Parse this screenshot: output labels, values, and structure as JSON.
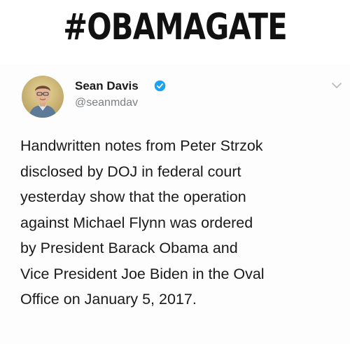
{
  "headline": "#OBAMAGATE",
  "tweet": {
    "author_name": "Sean Davis",
    "handle": "@seanmdav",
    "verified": true,
    "avatar_icon": "avatar-photo-icon",
    "verified_icon": "verified-badge-icon",
    "menu_icon": "chevron-down-icon",
    "accent_color": "#1da1f2",
    "lines": [
      "Handwritten notes from Peter Strzok",
      "disclosed by DOJ in federal court",
      "yesterday show that the operation",
      "against Michael Flynn was ordered",
      "by President Barack Obama and",
      "Vice President Joe Biden in the Oval",
      "Office on January 5, 2017."
    ]
  }
}
